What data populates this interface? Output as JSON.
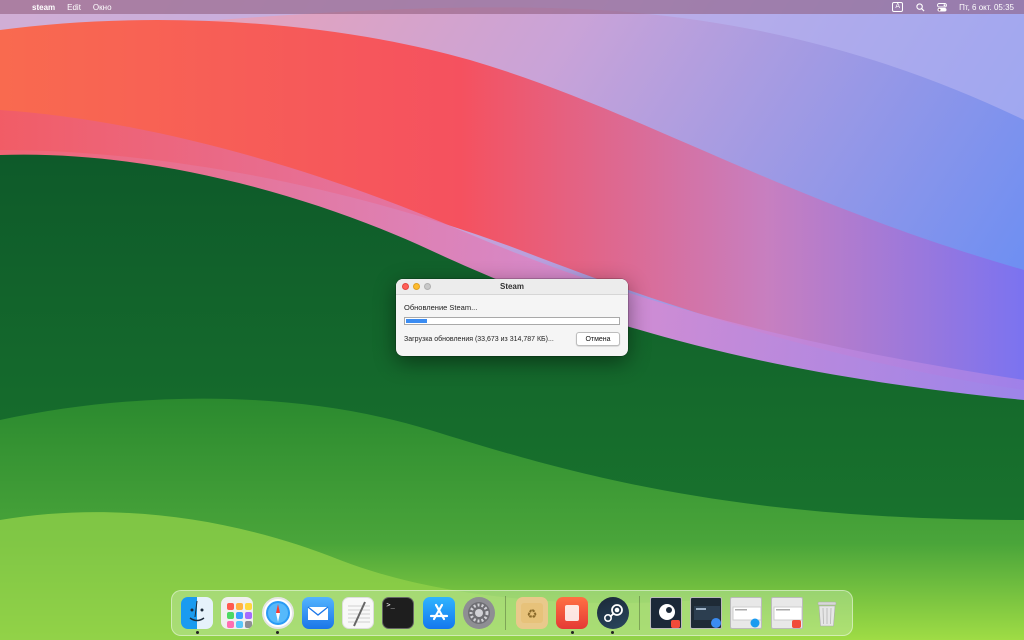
{
  "menubar": {
    "apple_glyph": "",
    "app_name": "steam",
    "menus": [
      "Edit",
      "Окно"
    ],
    "input_source": "A",
    "datetime": "Пт, 6 окт.  05:35"
  },
  "dialog": {
    "title": "Steam",
    "status": "Обновление Steam...",
    "progress_fraction": 0.1,
    "detail": "Загрузка обновления (33,673 из 314,787 КБ)...",
    "cancel_label": "Отмена"
  },
  "dock": {
    "apps": [
      {
        "name": "finder",
        "running": true
      },
      {
        "name": "launchpad",
        "running": false
      },
      {
        "name": "safari",
        "running": true
      },
      {
        "name": "mail",
        "running": false
      },
      {
        "name": "textedit",
        "running": false
      },
      {
        "name": "terminal",
        "running": false
      },
      {
        "name": "app-store",
        "running": false
      },
      {
        "name": "system-settings",
        "running": false
      }
    ],
    "recent": [
      {
        "name": "archive-utility",
        "running": false
      },
      {
        "name": "app-red",
        "running": true
      },
      {
        "name": "steam",
        "running": true
      }
    ],
    "windows": [
      "steam-window",
      "steam-window-2",
      "finder-window",
      "app-window"
    ],
    "trash": "trash"
  },
  "colors": {
    "accent": "#3b8cf2",
    "close": "#ff5f57",
    "minimize": "#febc2e"
  }
}
